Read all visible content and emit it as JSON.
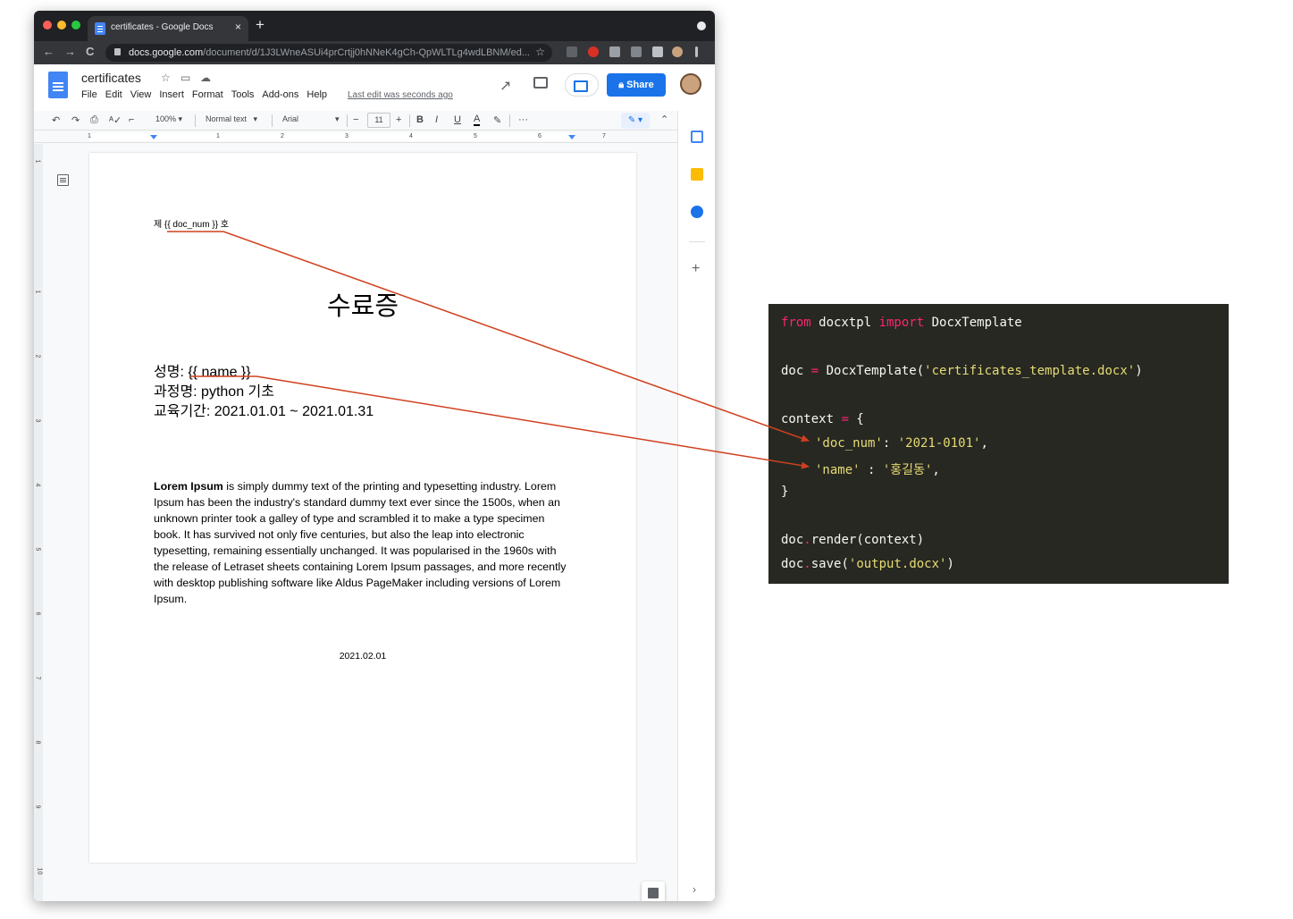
{
  "browser": {
    "tab_title": "certificates - Google Docs",
    "tab_close": "×",
    "new_tab": "+",
    "back": "←",
    "forward": "→",
    "reload": "C",
    "url_host": "docs.google.com",
    "url_path": "/document/d/1J3LWneASUi4prCrtjj0hNNeK4gCh-QpWLTLg4wdLBNM/ed...",
    "bookmark_star": "☆"
  },
  "docs": {
    "title": "certificates",
    "menu": [
      "File",
      "Edit",
      "View",
      "Insert",
      "Format",
      "Tools",
      "Add-ons",
      "Help"
    ],
    "last_edit": "Last edit was seconds ago",
    "share_label": "Share"
  },
  "format_toolbar": {
    "zoom": "100%",
    "style": "Normal text",
    "font": "Arial",
    "font_size": "11",
    "minus": "−",
    "plus": "+",
    "bold": "B",
    "italic": "I",
    "underline": "U",
    "text_color": "A",
    "more": "···"
  },
  "ruler": {
    "numbers": [
      "1",
      "1",
      "2",
      "3",
      "4",
      "5",
      "6",
      "7"
    ]
  },
  "vertical_ruler": {
    "numbers": [
      "1",
      "1",
      "2",
      "3",
      "4",
      "5",
      "6",
      "7",
      "8",
      "9",
      "10"
    ]
  },
  "document": {
    "doc_num_line": "제 {{ doc_num }} 호",
    "title": "수료증",
    "name_line": "성명: {{ name }}",
    "course_line": "과정명: python 기초",
    "period_line": "교육기간: 2021.01.01 ~ 2021.01.31",
    "lorem_bold": "Lorem Ipsum",
    "lorem_text": " is simply dummy text of the printing and typesetting industry. Lorem Ipsum has been the industry's standard dummy text ever since the 1500s, when an unknown printer took a galley of type and scrambled it to make a type specimen book. It has survived not only five centuries, but also the leap into electronic typesetting, remaining essentially unchanged. It was popularised in the 1960s with the release of Letraset sheets containing Lorem Ipsum passages, and more recently with desktop publishing software like Aldus PageMaker including versions of Lorem Ipsum.",
    "date": "2021.02.01"
  },
  "side_panel": {
    "plus": "+",
    "chevron": "›"
  },
  "code": {
    "l1_kw1": "from",
    "l1_mod": " docxtpl ",
    "l1_kw2": "import",
    "l1_cls": " DocxTemplate",
    "l2_var": "doc ",
    "l2_eq": "=",
    "l2_call": " DocxTemplate(",
    "l2_str": "'certificates_template.docx'",
    "l2_close": ")",
    "l3_var": "context ",
    "l3_eq": "=",
    "l3_brace": " {",
    "l4_key": "'doc_num'",
    "l4_colon": ": ",
    "l4_val": "'2021-0101'",
    "l4_comma": ",",
    "l5_key": "'name'",
    "l5_colon": " : ",
    "l5_val": "'홍길동'",
    "l5_comma": ",",
    "l6_brace": "}",
    "l7_obj": "doc",
    "l7_dot": ".",
    "l7_call": "render(context)",
    "l8_obj": "doc",
    "l8_dot": ".",
    "l8_call": "save(",
    "l8_str": "'output.docx'",
    "l8_close": ")"
  },
  "colors": {
    "arrow": "#d0401e",
    "share_blue": "#1a73e8",
    "code_bg": "#272822",
    "code_keyword": "#f92672",
    "code_string": "#e6db74"
  }
}
